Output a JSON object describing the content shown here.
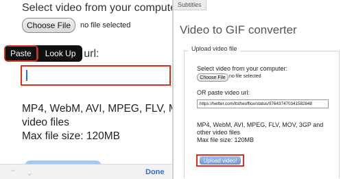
{
  "left": {
    "select_label": "Select video from your computer",
    "choose_button": "Choose File",
    "no_file": "no file selected",
    "context_menu": {
      "paste": "Paste",
      "look_up": "Look Up"
    },
    "url_label_partial": "eo url:",
    "formats_line1": "MP4, WebM, AVI, MPEG, FLV, MC",
    "formats_line2": "video files",
    "max_size": "Max file size: 120MB",
    "keyboard_bar": {
      "done": "Done"
    }
  },
  "right": {
    "tab": "Subtitles",
    "title": "Video to GIF converter",
    "legend": "Upload video file",
    "select_label": "Select video from your computer:",
    "choose_button": "Choose File",
    "no_file": "no file selected",
    "paste_label": "OR paste video url:",
    "url_value": "https://twitter.com/itstheoffice/status/976437470341582848",
    "formats": "MP4, WebM, AVI, MPEG, FLV, MOV, 3GP and other video files",
    "max_size": "Max file size: 120MB",
    "upload_button": "Upload video!"
  },
  "colors": {
    "highlight": "#d9311b",
    "button_blue": "#6f96d6"
  }
}
